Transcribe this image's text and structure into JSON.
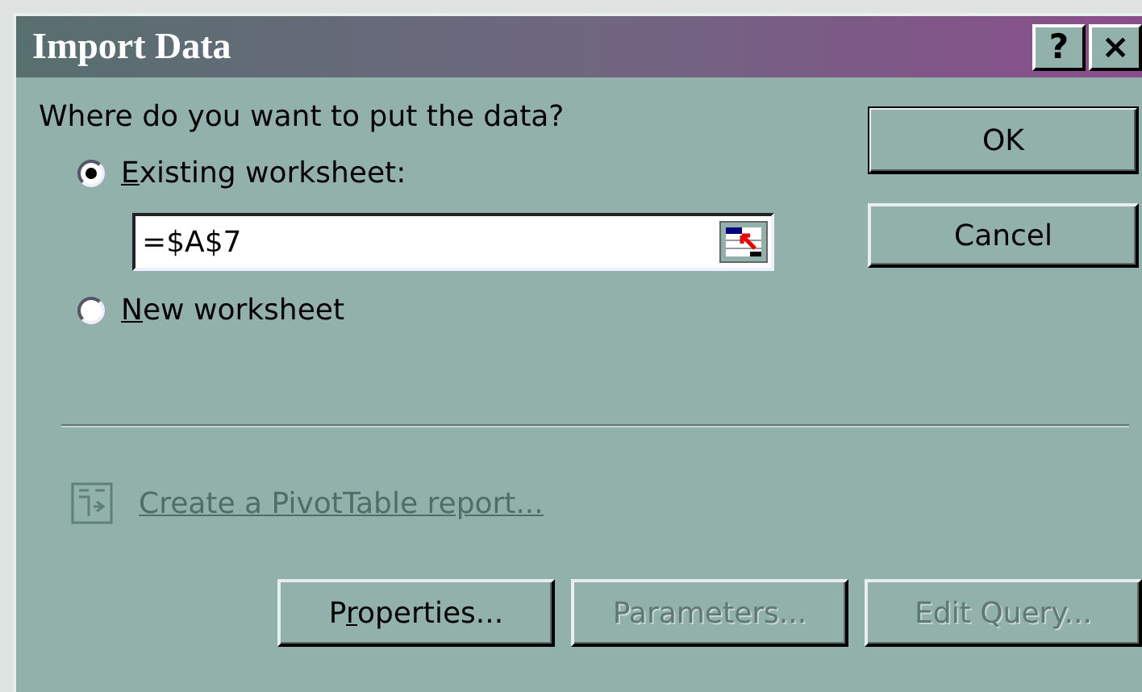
{
  "window": {
    "title": "Import Data",
    "title_buttons": [
      "?",
      "×"
    ]
  },
  "prompt": "Where do you want to put the data?",
  "options": [
    {
      "key": "E",
      "after": "xisting worksheet:",
      "selected": true
    },
    {
      "key": "N",
      "after": "ew worksheet",
      "selected": false
    }
  ],
  "range_field": {
    "value": "=$A$7"
  },
  "side_buttons": [
    {
      "label": "OK",
      "default": true
    },
    {
      "label": "Cancel",
      "default": false
    }
  ],
  "pivot_link": {
    "label": "Create a PivotTable report...",
    "disabled": true
  },
  "bottom_buttons": [
    {
      "before": "P",
      "key": "r",
      "after": "operties...",
      "disabled": false
    },
    {
      "after": "Parameters...",
      "disabled": true
    },
    {
      "after": "Edit Query...",
      "disabled": true
    }
  ]
}
